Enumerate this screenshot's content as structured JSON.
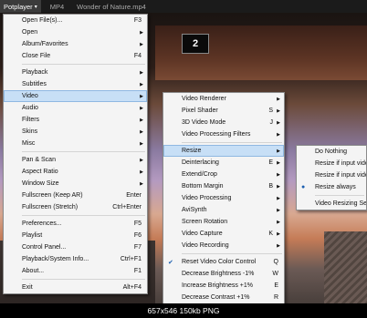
{
  "titlebar": {
    "app": "Potplayer",
    "format": "MP4",
    "file": "Wonder of Nature.mp4"
  },
  "badge": "2",
  "watermark": "657x546 150kb PNG",
  "main_menu": [
    {
      "label": "Open File(s)...",
      "shortcut": "F3"
    },
    {
      "label": "Open",
      "arrow": true
    },
    {
      "label": "Album/Favorites",
      "arrow": true
    },
    {
      "label": "Close File",
      "shortcut": "F4"
    },
    {
      "sep": true
    },
    {
      "label": "Playback",
      "arrow": true
    },
    {
      "label": "Subtitles",
      "arrow": true
    },
    {
      "label": "Video",
      "arrow": true,
      "highlight": true
    },
    {
      "label": "Audio",
      "arrow": true
    },
    {
      "label": "Filters",
      "arrow": true
    },
    {
      "label": "Skins",
      "arrow": true
    },
    {
      "label": "Misc",
      "arrow": true
    },
    {
      "sep": true
    },
    {
      "label": "Pan & Scan",
      "arrow": true
    },
    {
      "label": "Aspect Ratio",
      "arrow": true
    },
    {
      "label": "Window Size",
      "arrow": true
    },
    {
      "label": "Fullscreen (Keep AR)",
      "shortcut": "Enter"
    },
    {
      "label": "Fullscreen (Stretch)",
      "shortcut": "Ctrl+Enter"
    },
    {
      "sep": true
    },
    {
      "label": "Preferences...",
      "shortcut": "F5"
    },
    {
      "label": "Playlist",
      "shortcut": "F6"
    },
    {
      "label": "Control Panel...",
      "shortcut": "F7"
    },
    {
      "label": "Playback/System Info...",
      "shortcut": "Ctrl+F1"
    },
    {
      "label": "About...",
      "shortcut": "F1"
    },
    {
      "sep": true
    },
    {
      "label": "Exit",
      "shortcut": "Alt+F4"
    }
  ],
  "video_menu": [
    {
      "label": "Video Renderer",
      "arrow": true
    },
    {
      "label": "Pixel Shader",
      "shortcut": "S",
      "arrow": true
    },
    {
      "label": "3D Video Mode",
      "shortcut": "J",
      "arrow": true
    },
    {
      "label": "Video Processing Filters",
      "arrow": true
    },
    {
      "sep": true
    },
    {
      "label": "Resize",
      "arrow": true,
      "highlight": true
    },
    {
      "label": "Deinterlacing",
      "shortcut": "E",
      "arrow": true
    },
    {
      "label": "Extend/Crop",
      "arrow": true
    },
    {
      "label": "Bottom Margin",
      "shortcut": "B",
      "arrow": true
    },
    {
      "label": "Video Processing",
      "arrow": true
    },
    {
      "label": "AviSynth",
      "arrow": true
    },
    {
      "label": "Screen Rotation",
      "arrow": true
    },
    {
      "label": "Video Capture",
      "shortcut": "K",
      "arrow": true
    },
    {
      "label": "Video Recording",
      "arrow": true
    },
    {
      "sep": true
    },
    {
      "label": "Reset Video Color Control",
      "shortcut": "Q",
      "mark": "✔"
    },
    {
      "label": "Decrease Brightness -1%",
      "shortcut": "W"
    },
    {
      "label": "Increase Brightness +1%",
      "shortcut": "E"
    },
    {
      "label": "Decrease Contrast +1%",
      "shortcut": "R"
    }
  ],
  "resize_menu": [
    {
      "label": "Do Nothing"
    },
    {
      "label": "Resize if input video size"
    },
    {
      "label": "Resize if input video size"
    },
    {
      "label": "Resize always",
      "mark": "●"
    },
    {
      "sep": true
    },
    {
      "label": "Video Resizing Settings..."
    }
  ]
}
